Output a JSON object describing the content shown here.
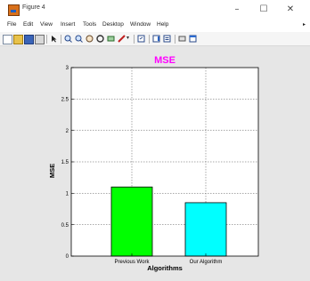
{
  "window": {
    "title": "Figure 4",
    "minimize_glyph": "–",
    "maximize_glyph": "☐",
    "close_glyph": "✕"
  },
  "menu": {
    "items": [
      "File",
      "Edit",
      "View",
      "Insert",
      "Tools",
      "Desktop",
      "Window",
      "Help"
    ],
    "overflow_glyph": "▸"
  },
  "toolbar": {
    "icons": [
      "new-figure-icon",
      "open-file-icon",
      "save-icon",
      "print-icon",
      "select-arrow-icon",
      "zoom-in-icon",
      "zoom-out-icon",
      "pan-icon",
      "rotate-3d-icon",
      "data-cursor-icon",
      "brush-icon",
      "brush-dropdown-icon",
      "link-plot-icon",
      "insert-colorbar-icon",
      "insert-legend-icon",
      "hide-plot-tools-icon",
      "show-plot-tools-icon"
    ]
  },
  "colors": {
    "title": "#ff00ff",
    "bar_previous_work": "#00ff00",
    "bar_our_algorithm": "#00ffff",
    "figure_bg": "#e6e6e6",
    "axes_bg": "#ffffff"
  },
  "chart_data": {
    "type": "bar",
    "title": "MSE",
    "xlabel": "Algorithms",
    "ylabel": "MSE",
    "categories": [
      "Previous Work",
      "Our Algorithm"
    ],
    "values": [
      1.1,
      0.85
    ],
    "ylim": [
      0,
      3
    ],
    "yticks": [
      "0",
      "0.5",
      "1",
      "1.5",
      "2",
      "2.5",
      "3"
    ],
    "grid": true
  }
}
